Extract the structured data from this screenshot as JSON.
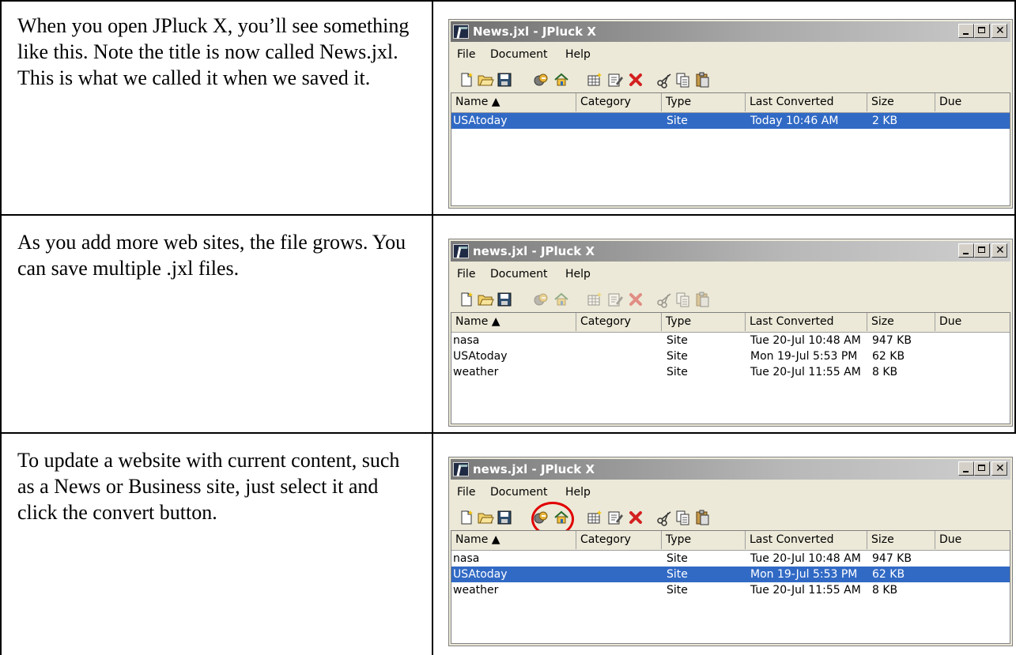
{
  "rows": [
    {
      "description": "When you open JPluck X, you’ll see something like this.  Note the title is now called News.jxl.  This is what we called it when we saved it.",
      "window": {
        "title": "News.jxl - JPluck X",
        "items": [
          {
            "name": "USAtoday",
            "category": "",
            "type": "Site",
            "last_converted": "Today 10:46 AM",
            "size": "2 KB",
            "due": "",
            "selected": true
          }
        ]
      }
    },
    {
      "description": "As you add more web sites, the file grows.  You can save multiple .jxl files.",
      "window": {
        "title": "news.jxl - JPluck X",
        "items": [
          {
            "name": "nasa",
            "category": "",
            "type": "Site",
            "last_converted": "Tue 20-Jul 10:48 AM",
            "size": "947 KB",
            "due": "",
            "selected": false
          },
          {
            "name": "USAtoday",
            "category": "",
            "type": "Site",
            "last_converted": "Mon 19-Jul 5:53 PM",
            "size": "62 KB",
            "due": "",
            "selected": false
          },
          {
            "name": "weather",
            "category": "",
            "type": "Site",
            "last_converted": "Tue 20-Jul 11:55 AM",
            "size": "8 KB",
            "due": "",
            "selected": false
          }
        ]
      }
    },
    {
      "description": "To update a website with current content, such as a News or Business site, just select it and click the convert button.",
      "window": {
        "title": "news.jxl - JPluck X",
        "items": [
          {
            "name": "nasa",
            "category": "",
            "type": "Site",
            "last_converted": "Tue 20-Jul 10:48 AM",
            "size": "947 KB",
            "due": "",
            "selected": false
          },
          {
            "name": "USAtoday",
            "category": "",
            "type": "Site",
            "last_converted": "Mon 19-Jul 5:53 PM",
            "size": "62 KB",
            "due": "",
            "selected": true
          },
          {
            "name": "weather",
            "category": "",
            "type": "Site",
            "last_converted": "Tue 20-Jul 11:55 AM",
            "size": "8 KB",
            "due": "",
            "selected": false
          }
        ]
      }
    }
  ],
  "menu": {
    "file": "File",
    "document": "Document",
    "help": "Help"
  },
  "columns": {
    "name": "Name ▲",
    "category": "Category",
    "type": "Type",
    "last_converted": "Last Converted",
    "size": "Size",
    "due": "Due"
  },
  "toolbar_icons": [
    "new-document-icon",
    "open-folder-icon",
    "save-disk-icon",
    "convert-icon",
    "home-icon",
    "add-site-icon",
    "edit-properties-icon",
    "delete-icon",
    "cut-icon",
    "copy-icon",
    "paste-icon"
  ],
  "colors": {
    "selection": "#316ac5",
    "highlight_ring": "#e00000",
    "window_face": "#ece9d8"
  }
}
